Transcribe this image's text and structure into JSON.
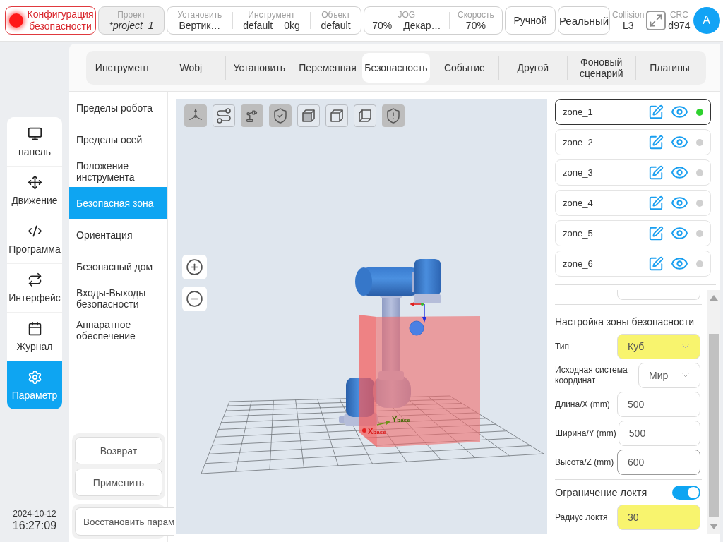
{
  "top_bar": {
    "safety_button": "Конфигурация безопасности",
    "project": {
      "label": "Проект",
      "value": "*project_1"
    },
    "status_groups": [
      {
        "fields": [
          {
            "label": "Установить",
            "values": [
              "Вертик…"
            ]
          },
          {
            "label": "Инструмент",
            "values": [
              "default",
              "0kg"
            ]
          },
          {
            "label": "Объект",
            "values": [
              "default"
            ]
          }
        ]
      },
      {
        "fields": [
          {
            "label": "JOG",
            "values": [
              "70%",
              "Декар…"
            ]
          },
          {
            "label": "Скорость",
            "values": [
              "70%"
            ]
          }
        ]
      }
    ],
    "mode_buttons": [
      {
        "kind": "mode",
        "label": "Ручной"
      },
      {
        "kind": "environment",
        "label": "Реальный"
      }
    ],
    "collision": {
      "label": "Collision",
      "value": "L3"
    },
    "crc": {
      "label": "CRC",
      "value": "d974"
    },
    "avatar": "A"
  },
  "tabs": [
    {
      "label": "Инструмент",
      "selected": false
    },
    {
      "label": "Wobj",
      "selected": false
    },
    {
      "label": "Установить",
      "selected": false
    },
    {
      "label": "Переменная",
      "selected": false
    },
    {
      "label": "Безопасность",
      "selected": true
    },
    {
      "label": "Событие",
      "selected": false
    },
    {
      "label": "Другой",
      "selected": false
    },
    {
      "label": "Фоновый сценарий",
      "selected": false
    },
    {
      "label": "Плагины",
      "selected": false
    }
  ],
  "nav": [
    {
      "label": "панель",
      "selected": false
    },
    {
      "label": "Движение",
      "selected": false
    },
    {
      "label": "Программа",
      "selected": false
    },
    {
      "label": "Интерфейс",
      "selected": false
    },
    {
      "label": "Журнал",
      "selected": false
    },
    {
      "label": "Параметр",
      "selected": true
    }
  ],
  "clock": {
    "date": "2024-10-12",
    "time": "16:27:09"
  },
  "submenu": {
    "items": [
      {
        "label": "Пределы робота",
        "selected": false
      },
      {
        "label": "Пределы осей",
        "selected": false
      },
      {
        "label": "Положение инструмента",
        "selected": false
      },
      {
        "label": "Безопасная зона",
        "selected": true
      },
      {
        "label": "Ориентация",
        "selected": false
      },
      {
        "label": "Безопасный дом",
        "selected": false
      },
      {
        "label": "Входы-Выходы безопасности",
        "selected": false
      },
      {
        "label": "Аппаратное обеспечение",
        "selected": false
      }
    ],
    "actions": [
      "Возврат",
      "Применить"
    ],
    "restore_button": "Восстановить парам"
  },
  "viewport": {
    "tools": [
      {
        "selected": true
      },
      {
        "selected": false
      },
      {
        "selected": true
      },
      {
        "selected": true
      },
      {
        "selected": false
      },
      {
        "selected": false
      },
      {
        "selected": false
      },
      {
        "selected": true
      }
    ],
    "axis_labels": [
      "X$_{base}$",
      "Y$_{base}$"
    ]
  },
  "zones": [
    {
      "name": "zone_1",
      "selected": true,
      "color": "#2ed12e"
    },
    {
      "name": "zone_2",
      "selected": false,
      "color": "#d0d0d0"
    },
    {
      "name": "zone_3",
      "selected": false,
      "color": "#d0d0d0"
    },
    {
      "name": "zone_4",
      "selected": false,
      "color": "#d0d0d0"
    },
    {
      "name": "zone_5",
      "selected": false,
      "color": "#d0d0d0"
    },
    {
      "name": "zone_6",
      "selected": false,
      "color": "#d0d0d0"
    }
  ],
  "zone_settings": {
    "title": "Настройка зоны безопасности",
    "fields": [
      {
        "kind": "select",
        "label": "Тип",
        "value": "Куб",
        "highlighted": true,
        "focused": false
      },
      {
        "kind": "select",
        "label": "Исходная система координат",
        "value": "Мир",
        "highlighted": false,
        "focused": false
      },
      {
        "kind": "input",
        "label": "Длина/X (mm)",
        "value": "500",
        "highlighted": false,
        "focused": false
      },
      {
        "kind": "input",
        "label": "Ширина/Y (mm)",
        "value": "500",
        "highlighted": false,
        "focused": false
      },
      {
        "kind": "input",
        "label": "Высота/Z (mm)",
        "value": "600",
        "highlighted": false,
        "focused": true
      }
    ],
    "elbow_limit": {
      "label": "Ограничение локтя",
      "on": true
    },
    "elbow_radius": {
      "label": "Радиус локтя",
      "value": "30",
      "highlighted": true
    }
  }
}
